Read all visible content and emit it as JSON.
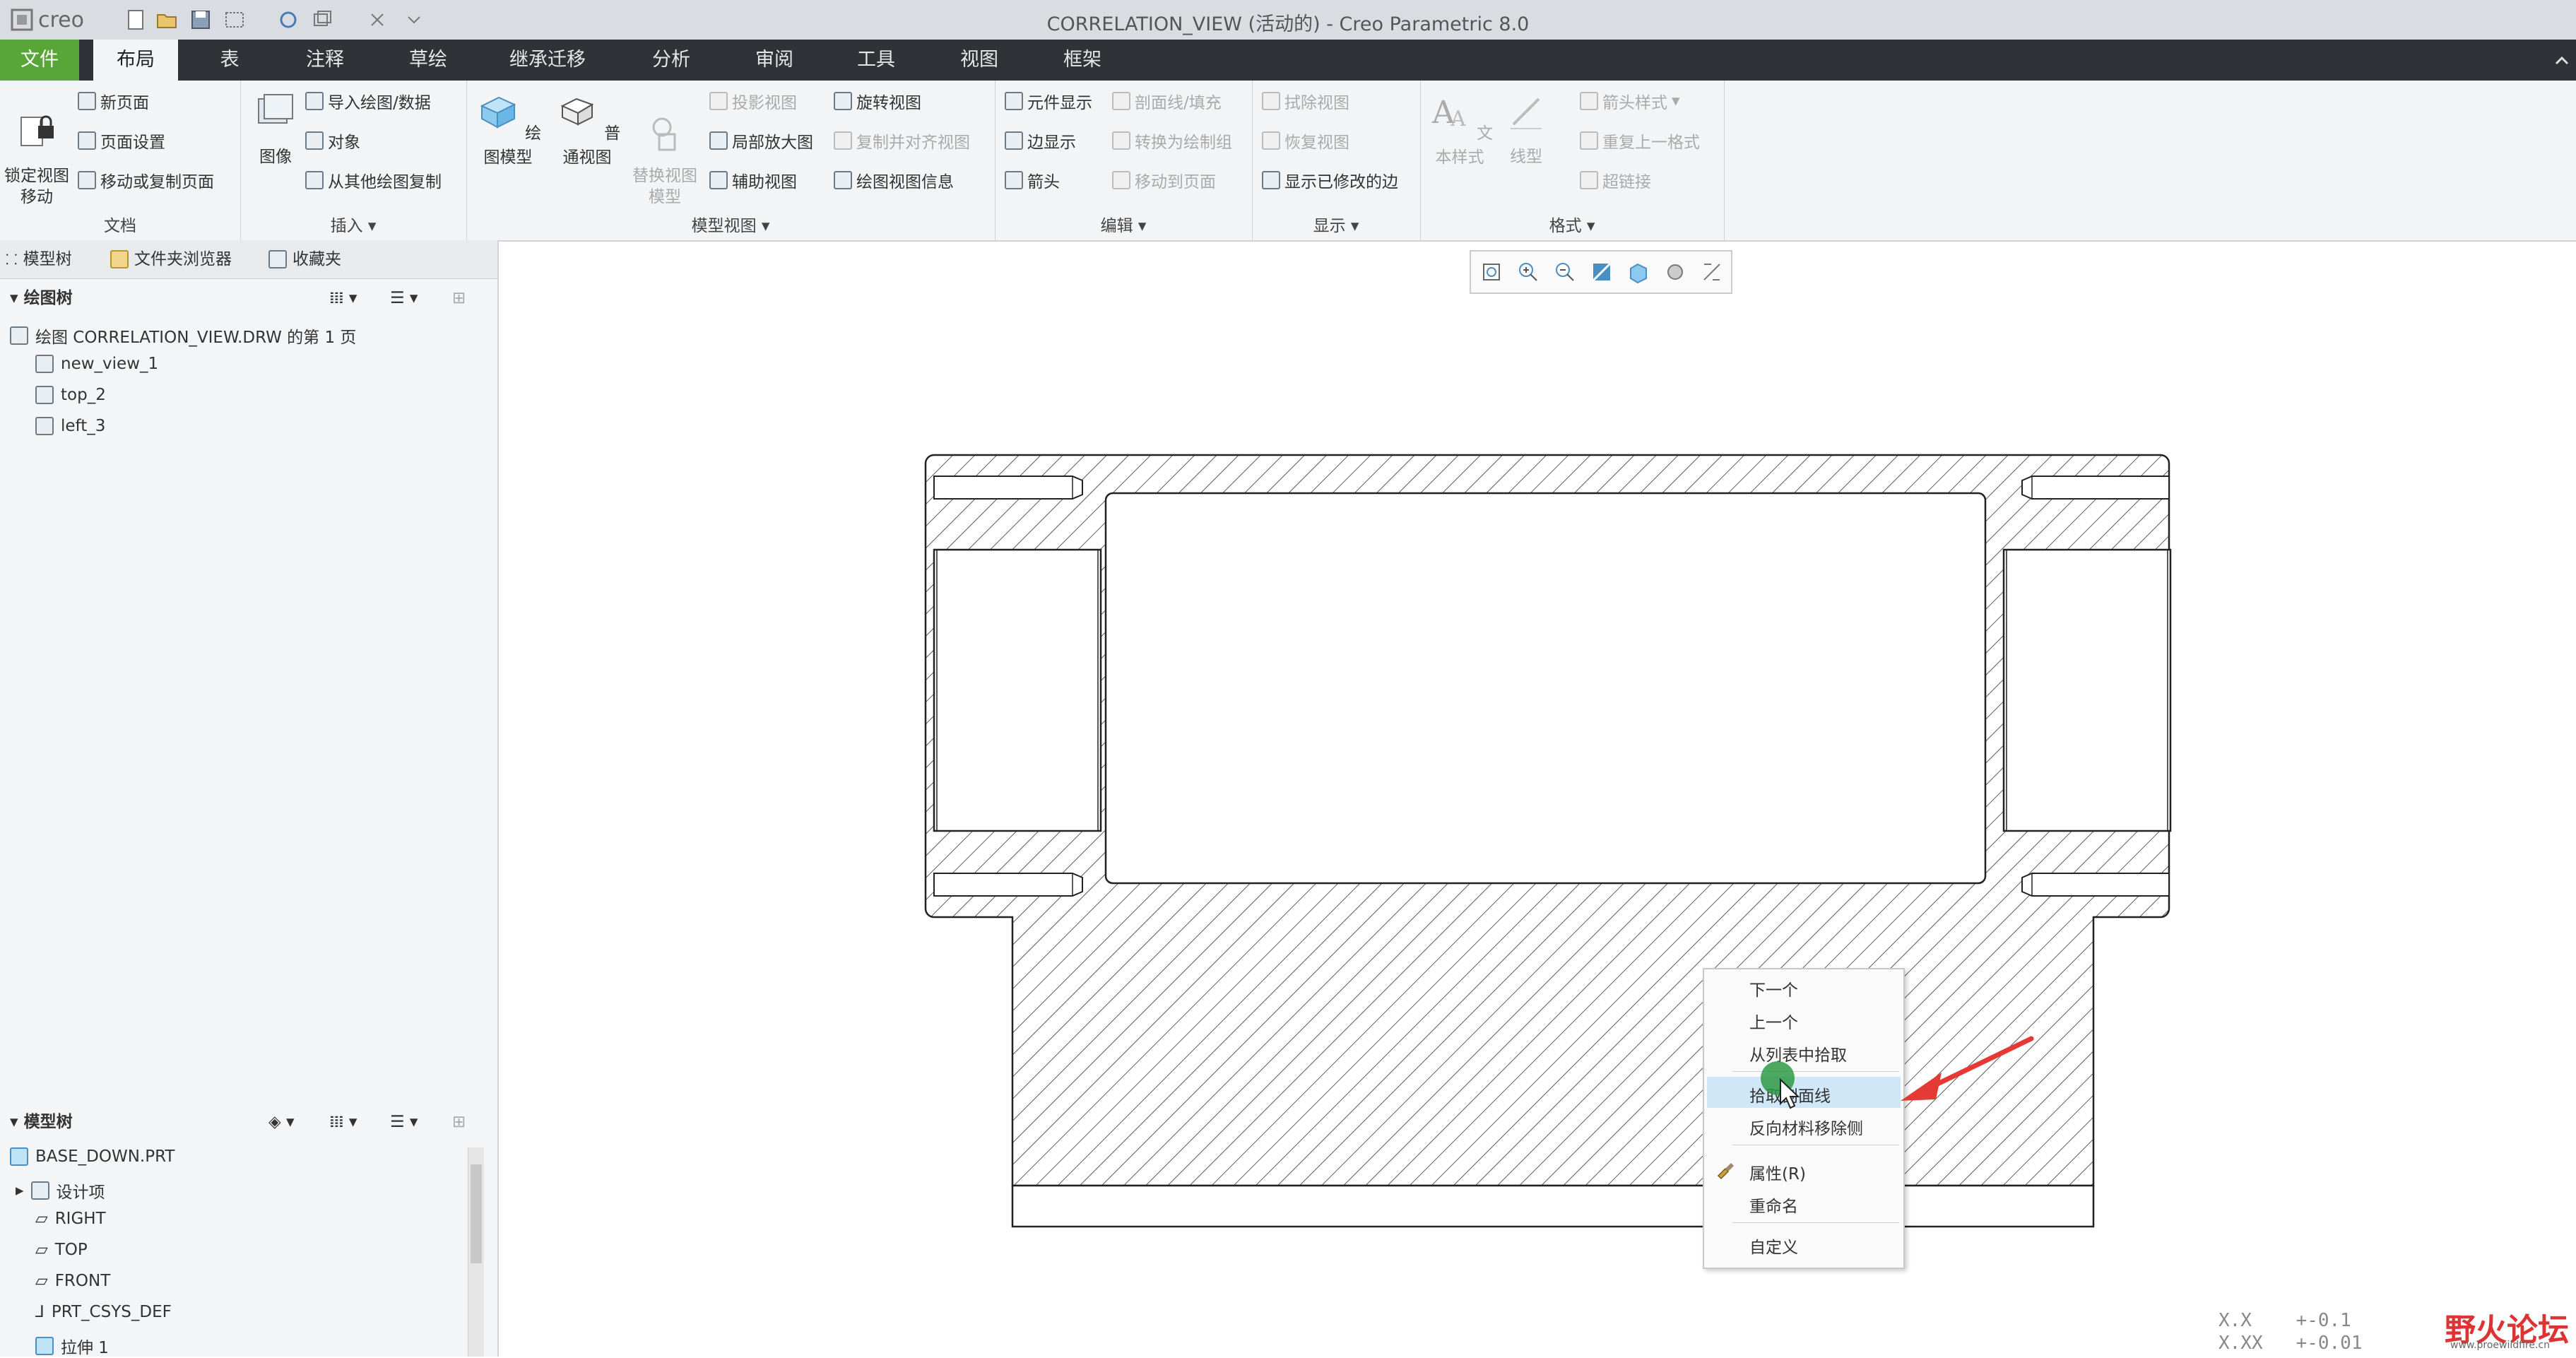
{
  "app": {
    "logo_text": "creo",
    "window_title": "CORRELATION_VIEW (活动的) - Creo Parametric 8.0"
  },
  "tabs": [
    "文件",
    "布局",
    "表",
    "注释",
    "草绘",
    "继承迁移",
    "分析",
    "审阅",
    "工具",
    "视图",
    "框架"
  ],
  "ribbon": {
    "doc": {
      "label": "文档",
      "lock_view": "锁定视图\n移动",
      "new_page": "新页面",
      "page_setup": "页面设置",
      "move_copy_page": "移动或复制页面"
    },
    "insert": {
      "label": "插入",
      "image": "图像",
      "import_data": "导入绘图/数据",
      "object": "对象",
      "copy_from_other": "从其他绘图复制"
    },
    "model_views": {
      "label": "模型视图",
      "drawing_model": "绘图模型",
      "general_view": "普通视图",
      "replace_view": "替换视图\n模型",
      "projection_view": "投影视图",
      "detailed_view": "局部放大图",
      "auxiliary_view": "辅助视图",
      "revolved_view": "旋转视图",
      "copy_align_view": "复制并对齐视图",
      "view_info": "绘图视图信息"
    },
    "edit": {
      "label": "编辑",
      "element_display": "元件显示",
      "edge_display": "边显示",
      "arrow": "箭头",
      "section_fill": "剖面线/填充",
      "convert_to_group": "转换为绘制组",
      "move_to_page": "移动到页面"
    },
    "display": {
      "label": "显示",
      "erase_view": "拭除视图",
      "resume_view": "恢复视图",
      "show_modified_edges": "显示已修改的边"
    },
    "format": {
      "label": "格式",
      "text_style": "文本样式",
      "line_style": "线型",
      "arrow_style": "箭头样式",
      "repeat_format": "重复上一格式",
      "hyperlink": "超链接"
    }
  },
  "left_panel": {
    "tabs": [
      "模型树",
      "文件夹浏览器",
      "收藏夹"
    ],
    "drawing_tree": {
      "title": "绘图树",
      "root": "绘图 CORRELATION_VIEW.DRW 的第 1 页",
      "items": [
        "new_view_1",
        "top_2",
        "left_3"
      ]
    },
    "model_tree": {
      "title": "模型树",
      "root": "BASE_DOWN.PRT",
      "items": [
        "设计项",
        "RIGHT",
        "TOP",
        "FRONT",
        "PRT_CSYS_DEF",
        "拉伸 1"
      ]
    }
  },
  "context_menu": {
    "items": [
      "下一个",
      "上一个",
      "从列表中拾取",
      "拾取剖面线",
      "反向材料移除侧",
      "属性(R)",
      "重命名",
      "自定义"
    ],
    "highlighted_index": 3
  },
  "status_coords": {
    "line1": "X.X    +-0.1",
    "line2": "X.XX   +-0.01"
  },
  "watermark": {
    "text": "野火论坛",
    "url": "www.proewildfire.cn"
  },
  "colors": {
    "file_tab": "#57a637",
    "tab_bar": "#2f3337",
    "highlight": "#cfe7f7",
    "arrow": "#e53935",
    "cursor_circle": "#2e9a44"
  }
}
